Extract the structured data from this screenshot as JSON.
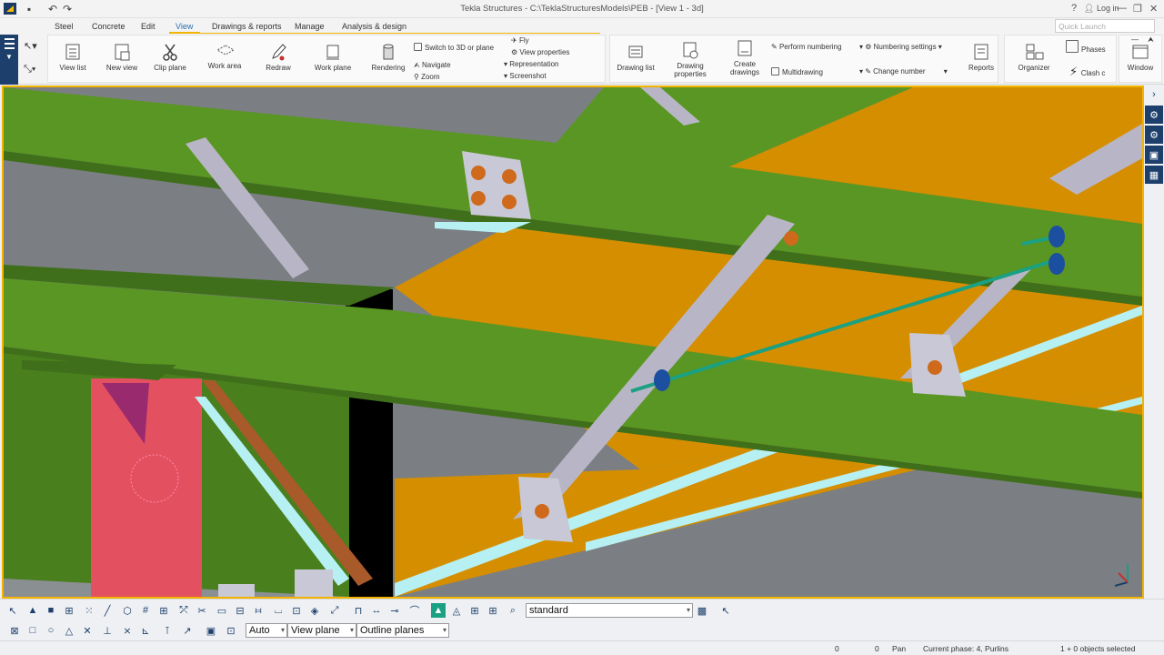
{
  "window": {
    "title": "Tekla Structures - C:\\TeklaStructuresModels\\PEB - [View 1 - 3d]",
    "help_glyph": "?",
    "login_label": "Log in",
    "minimize_glyph": "—",
    "restore_glyph": "❐",
    "close_glyph": "✕"
  },
  "menu": {
    "tabs": [
      "Steel",
      "Concrete",
      "Edit",
      "View",
      "Drawings & reports",
      "Manage",
      "Analysis & design"
    ],
    "active": "View",
    "quick_launch_placeholder": "Quick Launch"
  },
  "ribbon": {
    "buttons": {
      "view_list": "View list",
      "new_view": "New view",
      "clip_plane": "Clip plane",
      "work_area": "Work area",
      "redraw": "Redraw",
      "work_plane": "Work plane",
      "rendering": "Rendering",
      "drawing_list": "Drawing list",
      "drawing_properties": "Drawing properties",
      "create_drawings": "Create drawings",
      "reports": "Reports",
      "organizer": "Organizer",
      "window": "Window"
    },
    "small": {
      "switch_3d": "Switch to 3D or plane",
      "navigate": "Navigate",
      "zoom": "Zoom",
      "fly": "Fly",
      "view_properties": "View properties",
      "representation": "Representation",
      "screenshot": "Screenshot",
      "perform_numbering": "Perform numbering",
      "multidrawing": "Multidrawing",
      "numbering_settings": "Numbering settings",
      "change_number": "Change number",
      "phases": "Phases",
      "clash": "Clash c"
    }
  },
  "toolbar": {
    "selection_filter": "standard",
    "snap_depth": "Auto",
    "plane": "View plane",
    "plane_type": "Outline planes"
  },
  "status": {
    "coord_x": "0",
    "coord_y": "0",
    "mode": "Pan",
    "phase": "Current phase: 4, Purlins",
    "selection": "1 + 0 objects selected"
  },
  "colors": {
    "accent": "#f2b400",
    "beam_green": "#5a9623",
    "beam_dark": "#3f6f1a",
    "panel_orange": "#d58e00",
    "column_red": "#e35160",
    "brace_grey": "#b8b6c6",
    "bolt_orange": "#cf6a1c",
    "rod_teal": "#1aa082"
  }
}
